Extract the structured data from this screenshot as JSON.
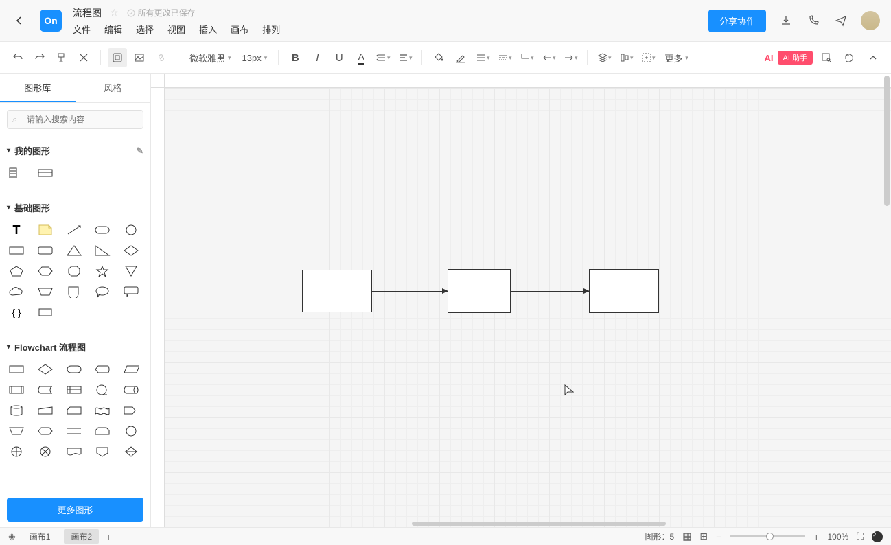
{
  "header": {
    "logo_text": "On",
    "title": "流程图",
    "save_status": "所有更改已保存",
    "menu": [
      "文件",
      "编辑",
      "选择",
      "视图",
      "插入",
      "画布",
      "排列"
    ],
    "share_label": "分享协作"
  },
  "toolbar": {
    "font": "微软雅黑",
    "font_size": "13px",
    "more_label": "更多",
    "ai_prefix": "AI",
    "ai_label": "AI 助手"
  },
  "sidebar": {
    "tabs": [
      "图形库",
      "风格"
    ],
    "search_placeholder": "请输入搜索内容",
    "sections": {
      "my_shapes": "我的图形",
      "basic": "基础图形",
      "flowchart": "Flowchart 流程图"
    },
    "more_shapes": "更多图形"
  },
  "statusbar": {
    "canvas_tabs": [
      "画布1",
      "画布2"
    ],
    "shape_count_label": "图形：",
    "shape_count": "5",
    "zoom": "100%"
  }
}
